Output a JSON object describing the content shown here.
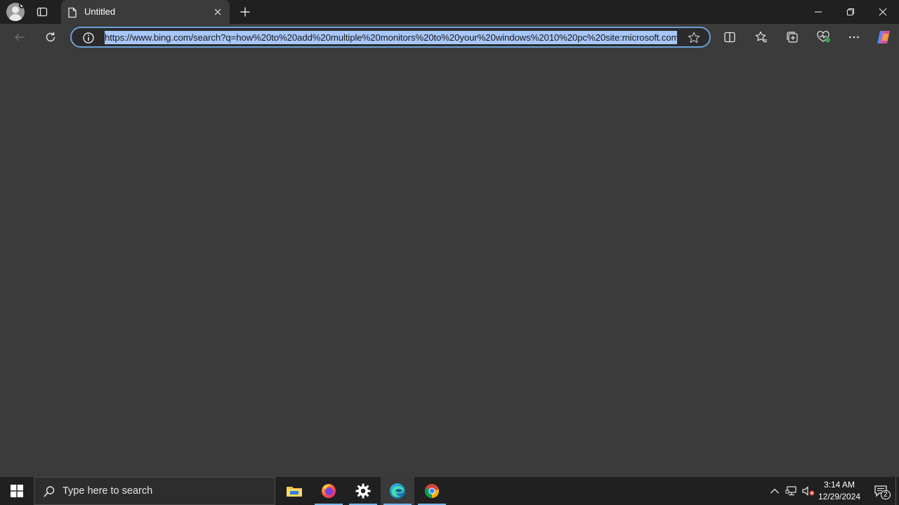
{
  "browser": {
    "tab": {
      "title": "Untitled",
      "icon": "page-icon"
    },
    "address_bar": {
      "url": "https://www.bing.com/search?q=how%20to%20add%20multiple%20monitors%20to%20your%20windows%2010%20pc%20site:microsoft.com",
      "info_icon": "info-icon",
      "favorite_icon": "star-icon"
    },
    "toolbar_icons": [
      "split-screen-icon",
      "favorites-icon",
      "collections-icon",
      "browser-essentials-icon",
      "more-icon",
      "copilot-icon"
    ]
  },
  "taskbar": {
    "search_placeholder": "Type here to search",
    "apps": [
      "file-explorer-icon",
      "firefox-icon",
      "settings-icon",
      "edge-icon",
      "chrome-icon"
    ],
    "clock": {
      "time": "3:14 AM",
      "date": "12/29/2024"
    },
    "notifications_count": "2"
  },
  "colors": {
    "chrome": "#202020",
    "page": "#3b3b3b",
    "accent": "#6aa0d8",
    "selection": "#a8c7fa"
  }
}
